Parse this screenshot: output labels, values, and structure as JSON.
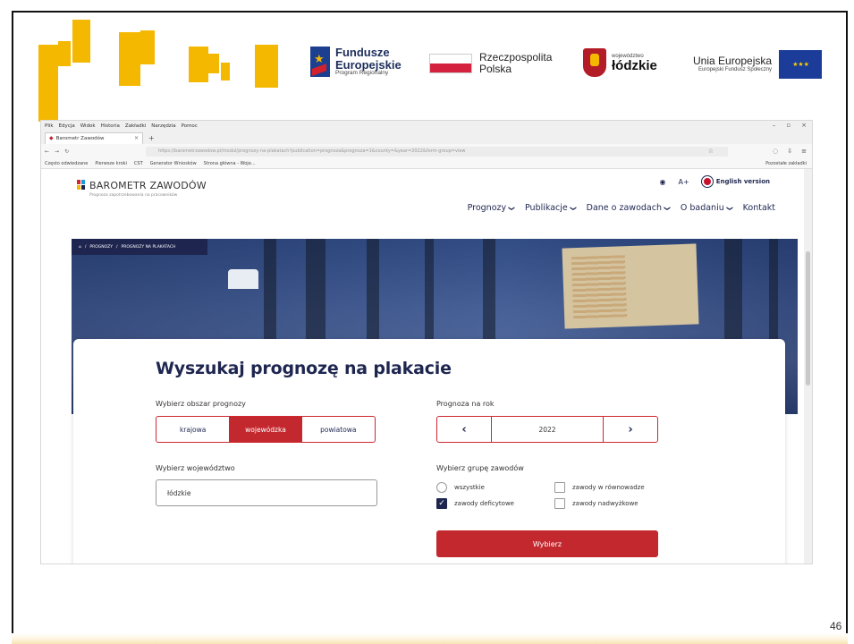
{
  "logos": {
    "fundusze_line1": "Fundusze",
    "fundusze_line2": "Europejskie",
    "fundusze_sub": "Program Regionalny",
    "rp_line1": "Rzeczpospolita",
    "rp_line2": "Polska",
    "lodz_small": "województwo",
    "lodz_big": "łódzkie",
    "ue_big": "Unia Europejska",
    "ue_small": "Europejski Fundusz Społeczny"
  },
  "browser": {
    "menu": [
      "Plik",
      "Edycja",
      "Widok",
      "Historia",
      "Zakładki",
      "Narzędzia",
      "Pomoc"
    ],
    "tab_title": "Barometr Zawodów",
    "url": "https://barometrzawodow.pl/modul/prognozy-na-plakatach?publication=prognoza&prognoza=1&county=&year=2022&form-group=view",
    "bookmarks": [
      "Często odwiedzane",
      "Pierwsze kroki",
      "CST",
      "Generator Wniosków",
      "Strona główna - Woje..."
    ],
    "bookmarks_right": "Pozostałe zakładki"
  },
  "site": {
    "brand_name": "BAROMETR ZAWODÓW",
    "brand_sub": "Prognoza zapotrzebowania na pracowników",
    "a_plus": "A+",
    "english": "English version",
    "nav": [
      "Prognozy",
      "Publikacje",
      "Dane o zawodach",
      "O badaniu",
      "Kontakt"
    ],
    "breadcrumb_1": "PROGNOZY",
    "breadcrumb_2": "PROGNOZY NA PLAKATACH"
  },
  "form": {
    "title": "Wyszukaj prognozę na plakacie",
    "area_label": "Wybierz obszar prognozy",
    "area_options": [
      "krajowa",
      "wojewódzka",
      "powiatowa"
    ],
    "year_label": "Prognoza na rok",
    "year": "2022",
    "woj_label": "Wybierz województwo",
    "woj_value": "łódzkie",
    "group_label": "Wybierz grupę zawodów",
    "opt_all": "wszystkie",
    "opt_deficit": "zawody deficytowe",
    "opt_balance": "zawody w równowadze",
    "opt_surplus": "zawody nadwyżkowe",
    "submit": "Wybierz"
  },
  "page_number": "46"
}
